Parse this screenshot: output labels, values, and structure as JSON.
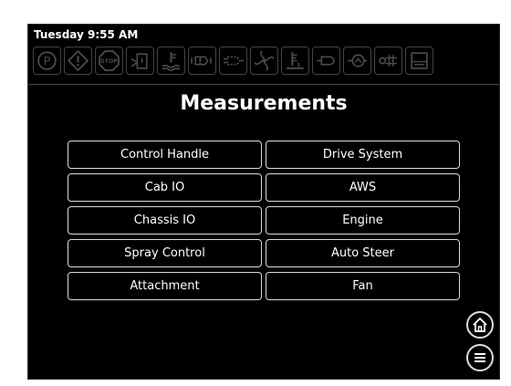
{
  "status_bar": {
    "datetime": "Tuesday 9:55 AM",
    "telltales": [
      "parking-brake-icon",
      "warning-icon",
      "stop-icon",
      "fuel-filter-icon",
      "coolant-temp-icon",
      "engine-warning-icon",
      "hydraulic-icon",
      "fan-speed-icon",
      "oil-level-icon",
      "hydraulic-oil-icon",
      "engine-oil-pressure-icon",
      "air-filter-icon",
      "tank-icon"
    ]
  },
  "page": {
    "title": "Measurements"
  },
  "menu": {
    "buttons": [
      "Control Handle",
      "Drive System",
      "Cab IO",
      "AWS",
      "Chassis IO",
      "Engine",
      "Spray Control",
      "Auto Steer",
      "Attachment",
      "Fan"
    ]
  },
  "nav": {
    "home_icon": "home-icon",
    "menu_icon": "menu-icon"
  },
  "colors": {
    "background": "#000000",
    "text": "#ffffff",
    "button_border": "#d9d9d9",
    "inactive_icon": "#4a4a4a"
  }
}
